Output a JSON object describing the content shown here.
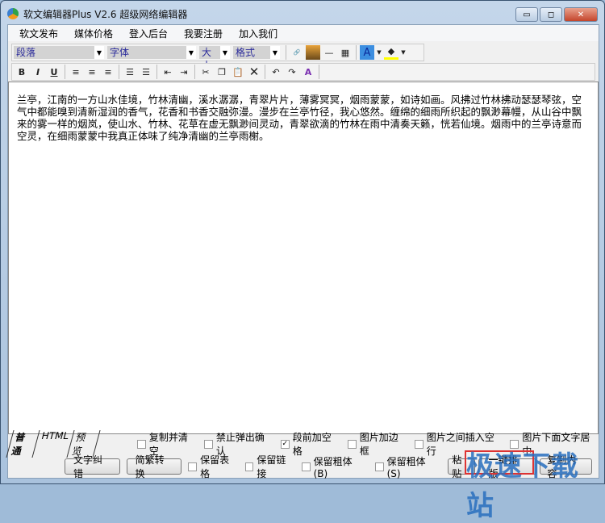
{
  "window": {
    "title": "软文编辑器Plus V2.6 超级网络编辑器",
    "minimize": "▭",
    "maximize": "◻",
    "close": "✕"
  },
  "menu": [
    "软文发布",
    "媒体价格",
    "登入后台",
    "我要注册",
    "加入我们"
  ],
  "toolbar": {
    "paragraph": "段落",
    "font": "字体",
    "size": "大小",
    "format": "格式"
  },
  "editor": {
    "content": "兰亭，江南的一方山水佳境，竹林清幽，溪水潺潺，青翠片片，薄雾冥冥，烟雨蒙蒙，如诗如画。风拂过竹林拂动瑟瑟琴弦，空气中都能嗅到清新湿润的香气，花香和书香交融弥漫。漫步在兰亭竹径，我心悠然。缠绵的细雨所织起的飘渺幕幔，从山谷中飘来的雾一样的烟岚，使山水、竹林、花草在虚无飘渺间灵动，青翠欲滴的竹林在雨中清奏天籁，恍若仙境。烟雨中的兰亭诗意而空灵，在细雨蒙蒙中我真正体味了纯净清幽的兰亭雨榭。"
  },
  "tabs": [
    "普通",
    "HTML",
    "预览"
  ],
  "options": [
    {
      "label": "复制并清空",
      "checked": false
    },
    {
      "label": "禁止弹出确认",
      "checked": false
    },
    {
      "label": "段前加空格",
      "checked": true
    },
    {
      "label": "图片加边框",
      "checked": false
    },
    {
      "label": "图片之间插入空行",
      "checked": false
    },
    {
      "label": "图片下面文字居中",
      "checked": false
    }
  ],
  "buttons": {
    "spell": "文字纠错",
    "convert": "简繁转换",
    "paste": "粘贴",
    "format": "一键排版",
    "last": "复制内容"
  },
  "keep": [
    {
      "label": "保留表格",
      "checked": false
    },
    {
      "label": "保留链接",
      "checked": false
    },
    {
      "label": "保留粗体 (B)",
      "checked": false
    },
    {
      "label": "保留粗体 (S)",
      "checked": false
    }
  ],
  "watermark": "极速下载站"
}
